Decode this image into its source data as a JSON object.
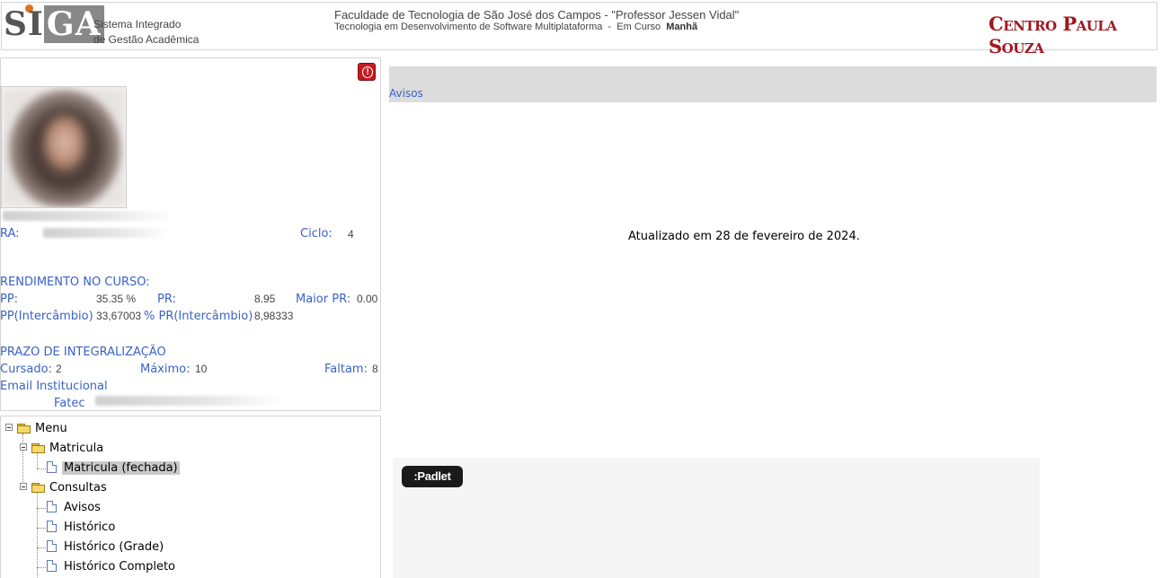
{
  "header": {
    "logo_text_s": "S",
    "logo_text_i": "I",
    "logo_text_ga": "GA",
    "logo_sub_line1": "Sistema Integrado",
    "logo_sub_line2": "de Gestão Acadêmica",
    "institution": "Faculdade de Tecnologia de São José dos Campos - \"Professor Jessen Vidal\"",
    "course_line": "Tecnologia em Desenvolvimento de Software Multiplataforma  -  Em Curso  ",
    "shift": "Manhã",
    "brand": "Centro Paula Souza",
    "brand_color": "#a3161e"
  },
  "student": {
    "alert_icon": "!",
    "ra_label": "RA:",
    "ciclo_label": "Ciclo:",
    "ciclo_value": "4",
    "rendimento_title": "RENDIMENTO NO CURSO:",
    "pp_label": "PP:",
    "pp_value": "35.35 %",
    "pr_label": "PR:",
    "pr_value": "8.95",
    "maior_pr_label": "Maior PR:",
    "maior_pr_value": "0.00",
    "pp_inter_label": "PP(Intercâmbio)",
    "pp_inter_value": "33,67003",
    "pr_inter_label": "% PR(Intercâmbio)",
    "pr_inter_value": "8,98333",
    "prazo_title": "PRAZO DE INTEGRALIZAÇÃO",
    "cursado_label": "Cursado:",
    "cursado_value": "2",
    "maximo_label": "Máximo:",
    "maximo_value": "10",
    "faltam_label": "Faltam:",
    "faltam_value": "8",
    "email_label": "Email Institucional",
    "fatec_label": "Fatec"
  },
  "menu": {
    "root": "Menu",
    "groups": [
      {
        "label": "Matricula",
        "items": [
          "Matricula (fechada)"
        ]
      },
      {
        "label": "Consultas",
        "items": [
          "Avisos",
          "Histórico",
          "Histórico (Grade)",
          "Histórico Completo"
        ]
      }
    ]
  },
  "main": {
    "avisos_link": "Avisos",
    "updated_text": "Atualizado em 28 de fevereiro de 2024.",
    "padlet_label": ":Padlet"
  },
  "colors": {
    "link_blue": "#3a62c6",
    "avisos_bar": "#dcdcdc",
    "alert_red": "#c8191f"
  }
}
